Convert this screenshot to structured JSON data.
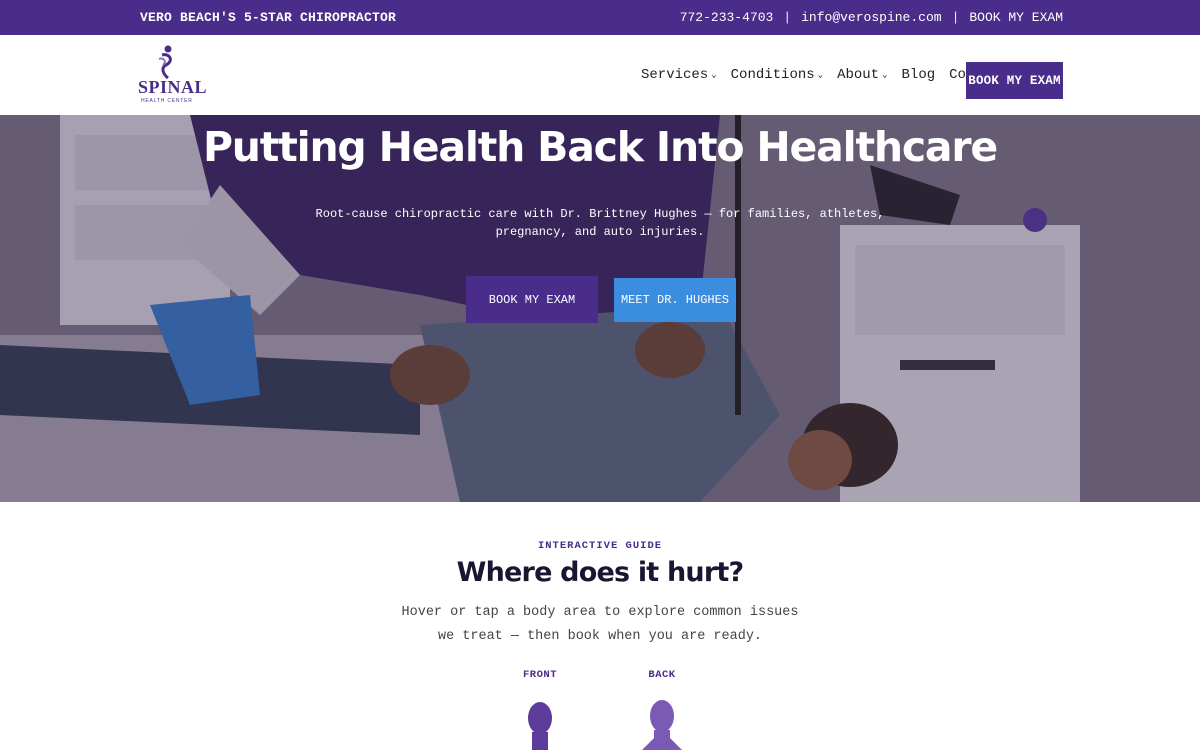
{
  "topbar": {
    "tagline": "VERO BEACH'S 5-STAR CHIROPRACTOR",
    "phone": "772-233-4703",
    "separator": "|",
    "email": "info@verospine.com",
    "book": "BOOK MY EXAM"
  },
  "brand": {
    "logo_text": "SPINAL",
    "logo_subtext": "HEALTH CENTER"
  },
  "nav": {
    "items": [
      {
        "label": "Services",
        "has_dropdown": true
      },
      {
        "label": "Conditions",
        "has_dropdown": true
      },
      {
        "label": "About",
        "has_dropdown": true
      },
      {
        "label": "Blog",
        "has_dropdown": false
      },
      {
        "label": "Contact",
        "has_dropdown": false
      }
    ],
    "chevron": "⌄",
    "cta": "BOOK MY EXAM"
  },
  "hero": {
    "title": "Putting Health Back Into Healthcare",
    "subtitle": "Root-cause chiropractic care with Dr. Brittney Hughes — for families, athletes, pregnancy, and auto injuries.",
    "primary_button": "BOOK MY EXAM",
    "secondary_button": "MEET DR. HUGHES"
  },
  "guide": {
    "eyebrow": "INTERACTIVE GUIDE",
    "title": "Where does it hurt?",
    "description": "Hover or tap a body area to explore common issues we treat — then book when you are ready.",
    "front_label": "FRONT",
    "back_label": "BACK"
  },
  "colors": {
    "brand_purple": "#4a2d8a",
    "accent_blue": "#3b8de0"
  }
}
